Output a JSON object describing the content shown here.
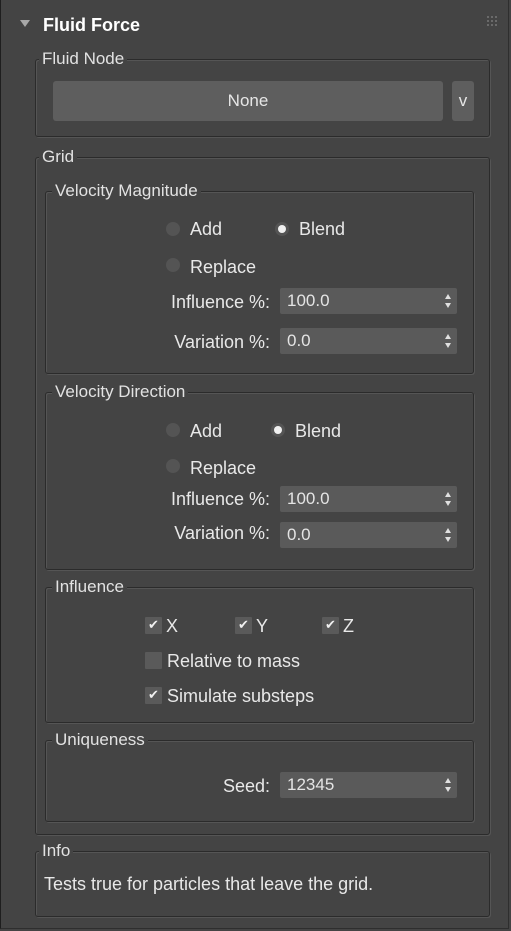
{
  "rollout": {
    "title": "Fluid Force"
  },
  "fluid_node": {
    "group_label": "Fluid Node",
    "node_button_label": "None",
    "pick_button_label": "v"
  },
  "grid": {
    "group_label": "Grid",
    "velocity_magnitude": {
      "group_label": "Velocity Magnitude",
      "mode_options": [
        "Add",
        "Blend",
        "Replace"
      ],
      "selected_mode": "Blend",
      "influence_label": "Influence %:",
      "influence_value": "100.0",
      "variation_label": "Variation %:",
      "variation_value": "0.0"
    },
    "velocity_direction": {
      "group_label": "Velocity Direction",
      "mode_options": [
        "Add",
        "Blend",
        "Replace"
      ],
      "selected_mode": "Blend",
      "influence_label": "Influence %:",
      "influence_value": "100.0",
      "variation_label": "Variation %:",
      "variation_value": "0.0"
    },
    "influence": {
      "group_label": "Influence",
      "axis_x_label": "X",
      "axis_x_checked": true,
      "axis_y_label": "Y",
      "axis_y_checked": true,
      "axis_z_label": "Z",
      "axis_z_checked": true,
      "relative_to_mass_label": "Relative to mass",
      "relative_to_mass_checked": false,
      "simulate_substeps_label": "Simulate substeps",
      "simulate_substeps_checked": true
    },
    "uniqueness": {
      "group_label": "Uniqueness",
      "seed_label": "Seed:",
      "seed_value": "12345"
    }
  },
  "info": {
    "group_label": "Info",
    "text": "Tests true for particles that leave the grid."
  }
}
